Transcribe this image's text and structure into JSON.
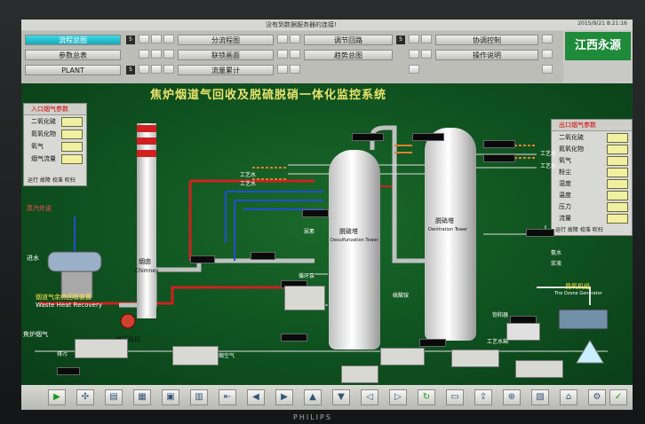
{
  "status": {
    "message": "没有到数据服务器的连接!",
    "datetime": "2015/9/21 8:21:16"
  },
  "menu": {
    "row1": [
      "流程总图",
      "分流程图",
      "调节回路",
      "协调控制"
    ],
    "row2": [
      "参数总表",
      "联锁画面",
      "趋势总图",
      "操作说明"
    ],
    "row3": [
      "PLANT",
      "流量累计"
    ],
    "stepper_label": "5"
  },
  "logo": "江西永源",
  "title": "焦炉烟道气回收及脱硫脱硝一体化监控系统",
  "inlet_panel": {
    "header": "入口烟气参数",
    "rows": [
      "二氧化硫",
      "氮氧化物",
      "氧气",
      "烟气流量"
    ],
    "footer": "运行 故障 校准 吹扫"
  },
  "outlet_panel": {
    "header": "出口烟气参数",
    "rows": [
      "二氧化硫",
      "氮氧化物",
      "氧气",
      "粉尘",
      "湿度",
      "温度",
      "压力",
      "流量"
    ],
    "footer": "运行 故障 校准 吹扫"
  },
  "labels": {
    "chimney_cn": "烟囱",
    "chimney_en": "Chimney",
    "desulf_cn": "脱硫塔",
    "desulf_en": "Desulfurization Tower",
    "denit_cn": "脱硝塔",
    "denit_en": "Denitration Tower",
    "whr_cn": "烟道气余热回收装置",
    "whr_en": "Waste Heat Recovery",
    "ozone_cn": "臭氧机组",
    "ozone_en": "The Ozone Generator",
    "fan": "增压风机",
    "coke_gas": "焦炉烟气",
    "water_in": "进水",
    "steam_out": "蒸汽外送",
    "process_water": "工艺水",
    "urea": "尿素",
    "ammonia": "氨水",
    "circ_pump": "循环泵",
    "sulfate": "硫酸铵",
    "air": "空气",
    "outside_air": "界外压缩空气",
    "slurry": "浆液",
    "sat_tank": "饱和器",
    "blow": "排污",
    "water_tank": "工艺水箱"
  },
  "toolbar": {
    "icons": [
      "play-icon",
      "fan-icon",
      "folder-icon",
      "chart-icon",
      "grid-icon",
      "table-icon",
      "back-icon",
      "prev-icon",
      "next-icon",
      "up-icon",
      "down-icon",
      "left-icon",
      "right-icon",
      "refresh-icon",
      "save-icon",
      "export-icon",
      "zoom-icon",
      "print-icon",
      "home-icon",
      "settings-icon",
      "help-icon",
      "check-icon"
    ]
  },
  "monitor_brand": "PHILIPS",
  "colors": {
    "background": "#0f5220",
    "title": "#e9e36a",
    "pipe_red": "#d02020",
    "pipe_blue": "#2050d0",
    "pipe_orange": "#e08030",
    "pipe_grey": "#c0c0c0"
  }
}
